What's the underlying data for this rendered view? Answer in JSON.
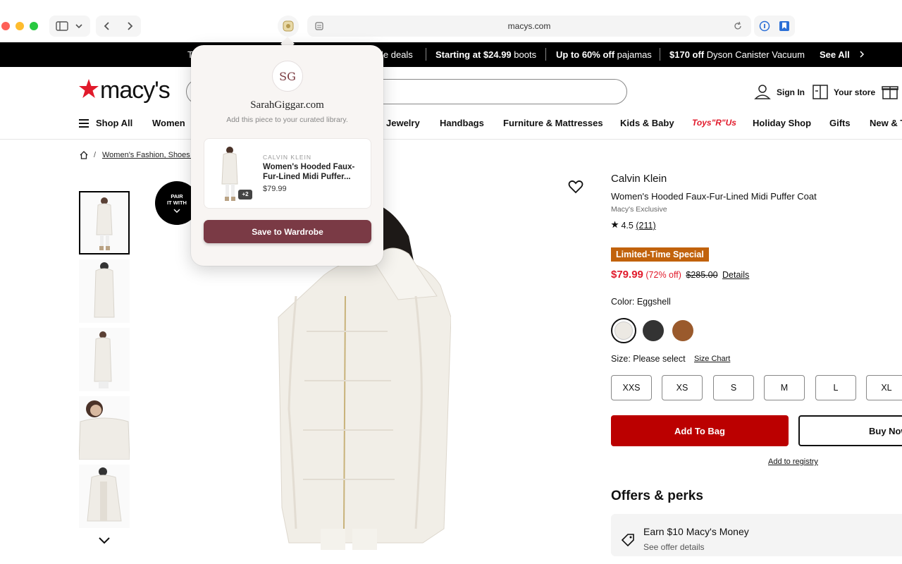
{
  "browser": {
    "url": "macys.com"
  },
  "promo": {
    "item_partial_left": "T",
    "item_partial_deals": "le deals",
    "boots_bold": "Starting at $24.99",
    "boots_tail": " boots",
    "pajamas_bold": "Up to 60% off",
    "pajamas_tail": " pajamas",
    "vacuum_bold": "$170 off",
    "vacuum_tail": " Dyson Canister Vacuum",
    "see_all": "See All"
  },
  "header": {
    "logo_text": "macy's",
    "sign_in": "Sign In",
    "your_store": "Your store"
  },
  "nav": {
    "shop_all": "Shop All",
    "items": [
      "Women",
      "Jewelry",
      "Handbags",
      "Furniture & Mattresses",
      "Kids & Baby",
      "Holiday Shop",
      "Gifts",
      "New & T"
    ],
    "toysrus": "Toys\"R\"Us"
  },
  "breadcrumb": {
    "sep": "/",
    "link": "Women's Fashion, Shoes &"
  },
  "pair_badge": {
    "line1": "PAIR",
    "line2": "IT WITH"
  },
  "product": {
    "brand": "Calvin Klein",
    "name": "Women's Hooded Faux-Fur-Lined Midi Puffer Coat",
    "exclusive": "Macy's Exclusive",
    "rating": "4.5",
    "review_count": "(211)",
    "badge": "Limited-Time Special",
    "price": "$79.99",
    "discount": "(72% off)",
    "original_price": "$285.00",
    "details": "Details",
    "color_label": "Color: Eggshell",
    "swatches": [
      "#ece9e3",
      "#333333",
      "#9a5a2c"
    ],
    "size_label": "Size: Please select",
    "size_chart": "Size Chart",
    "sizes": [
      "XXS",
      "XS",
      "S",
      "M",
      "L",
      "XL"
    ],
    "add_to_bag": "Add To Bag",
    "buy_now": "Buy Now",
    "registry": "Add to registry"
  },
  "offers": {
    "title": "Offers & perks",
    "item_title": "Earn $10 Macy's Money",
    "item_sub": "See offer details"
  },
  "extension": {
    "initials": "SG",
    "title": "SarahGiggar.com",
    "subtitle": "Add this piece to your curated library.",
    "card_brand": "CALVIN KLEIN",
    "card_name": "Women's Hooded Faux-Fur-Lined Midi Puffer...",
    "card_price": "$79.99",
    "card_more": "+2",
    "save_label": "Save to Wardrobe"
  },
  "colors": {
    "macys_red": "#e11a2b",
    "add_to_bag": "#bb0000",
    "badge_orange": "#c1620c",
    "extension_accent": "#7a3a45"
  }
}
